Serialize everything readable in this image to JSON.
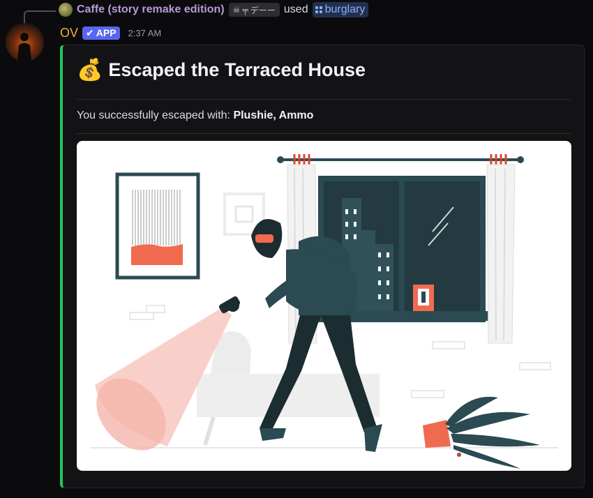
{
  "reply": {
    "username": "Caffe (story remake edition)",
    "tag": "デーー",
    "used_text": "used",
    "command": "burglary"
  },
  "message": {
    "username": "OV",
    "app_badge": "APP",
    "timestamp": "2:37 AM"
  },
  "embed": {
    "accent_color": "#23c55e",
    "title_emoji": "💰",
    "title": "Escaped the Terraced House",
    "description_prefix": "You successfully escaped with:",
    "description_items": "Plushie, Ammo"
  },
  "colors": {
    "username": "#f0b232",
    "reply_name": "#b69cd8",
    "app_badge": "#5865f2",
    "command": "#8ab0ff"
  }
}
